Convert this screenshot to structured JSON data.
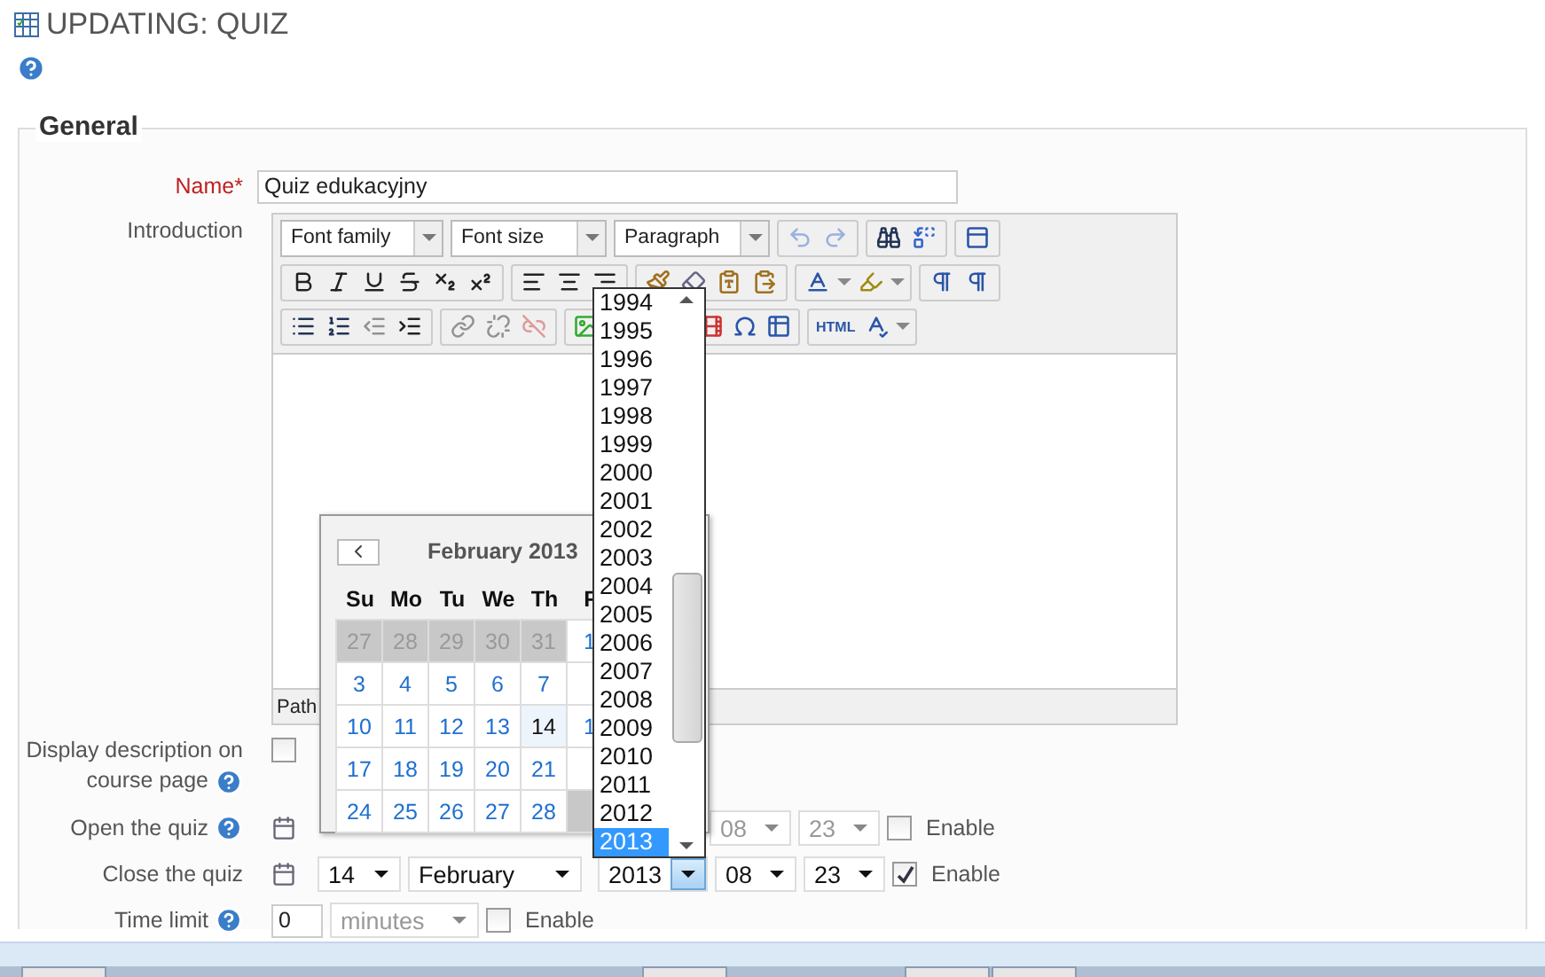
{
  "page": {
    "title": "UPDATING: QUIZ"
  },
  "section": {
    "legend": "General"
  },
  "name_field": {
    "label": "Name",
    "required_mark": "*",
    "value": "Quiz edukacyjny"
  },
  "introduction": {
    "label": "Introduction",
    "font_family": "Font family",
    "font_size": "Font size",
    "format": "Paragraph",
    "html_button": "HTML",
    "path_label": "Path"
  },
  "display_description": {
    "label": "Display description on course page",
    "checked": false
  },
  "open_quiz": {
    "label": "Open the quiz",
    "hour": "08",
    "minute": "23",
    "enable_label": "Enable",
    "enabled": false
  },
  "close_quiz": {
    "label": "Close the quiz",
    "day": "14",
    "month": "February",
    "year": "2013",
    "hour": "08",
    "minute": "23",
    "enable_label": "Enable",
    "enabled": true
  },
  "time_limit": {
    "label": "Time limit",
    "value": "0",
    "unit": "minutes",
    "enable_label": "Enable",
    "enabled": false
  },
  "calendar": {
    "title": "February 2013",
    "weekdays": [
      "Su",
      "Mo",
      "Tu",
      "We",
      "Th",
      "F"
    ],
    "weeks": [
      [
        {
          "day": "27",
          "muted": true,
          "today": false
        },
        {
          "day": "28",
          "muted": true,
          "today": false
        },
        {
          "day": "29",
          "muted": true,
          "today": false
        },
        {
          "day": "30",
          "muted": true,
          "today": false
        },
        {
          "day": "31",
          "muted": true,
          "today": false
        },
        {
          "day": "1",
          "muted": false,
          "today": false
        }
      ],
      [
        {
          "day": "3",
          "muted": false,
          "today": false
        },
        {
          "day": "4",
          "muted": false,
          "today": false
        },
        {
          "day": "5",
          "muted": false,
          "today": false
        },
        {
          "day": "6",
          "muted": false,
          "today": false
        },
        {
          "day": "7",
          "muted": false,
          "today": false
        },
        {
          "muted": false,
          "today": false
        }
      ],
      [
        {
          "day": "10",
          "muted": false,
          "today": false
        },
        {
          "day": "11",
          "muted": false,
          "today": false
        },
        {
          "day": "12",
          "muted": false,
          "today": false
        },
        {
          "day": "13",
          "muted": false,
          "today": false
        },
        {
          "day": "14",
          "muted": false,
          "today": true
        },
        {
          "day": "1",
          "muted": false,
          "today": false
        }
      ],
      [
        {
          "day": "17",
          "muted": false,
          "today": false
        },
        {
          "day": "18",
          "muted": false,
          "today": false
        },
        {
          "day": "19",
          "muted": false,
          "today": false
        },
        {
          "day": "20",
          "muted": false,
          "today": false
        },
        {
          "day": "21",
          "muted": false,
          "today": false
        },
        {
          "muted": false,
          "today": false
        }
      ],
      [
        {
          "day": "24",
          "muted": false,
          "today": false
        },
        {
          "day": "25",
          "muted": false,
          "today": false
        },
        {
          "day": "26",
          "muted": false,
          "today": false
        },
        {
          "day": "27",
          "muted": false,
          "today": false
        },
        {
          "day": "28",
          "muted": false,
          "today": false
        },
        {
          "muted": true,
          "today": false
        }
      ]
    ]
  },
  "year_list": [
    {
      "label": "1994",
      "selected": false
    },
    {
      "label": "1995",
      "selected": false
    },
    {
      "label": "1996",
      "selected": false
    },
    {
      "label": "1997",
      "selected": false
    },
    {
      "label": "1998",
      "selected": false
    },
    {
      "label": "1999",
      "selected": false
    },
    {
      "label": "2000",
      "selected": false
    },
    {
      "label": "2001",
      "selected": false
    },
    {
      "label": "2002",
      "selected": false
    },
    {
      "label": "2003",
      "selected": false
    },
    {
      "label": "2004",
      "selected": false
    },
    {
      "label": "2005",
      "selected": false
    },
    {
      "label": "2006",
      "selected": false
    },
    {
      "label": "2007",
      "selected": false
    },
    {
      "label": "2008",
      "selected": false
    },
    {
      "label": "2009",
      "selected": false
    },
    {
      "label": "2010",
      "selected": false
    },
    {
      "label": "2011",
      "selected": false
    },
    {
      "label": "2012",
      "selected": false
    },
    {
      "label": "2013",
      "selected": true
    }
  ]
}
